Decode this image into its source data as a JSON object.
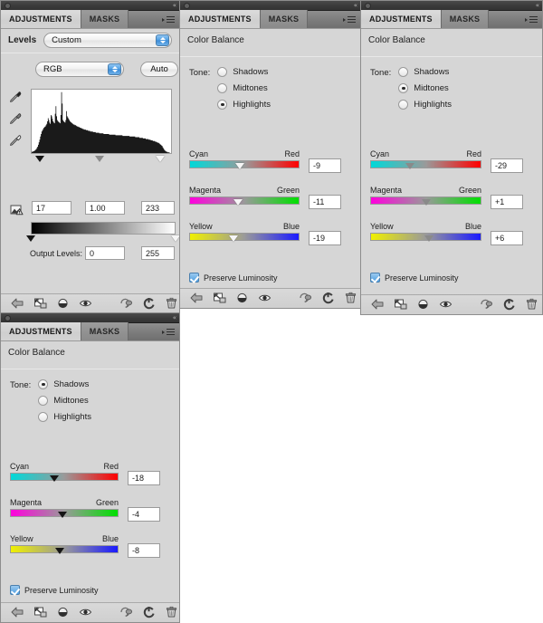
{
  "app": {
    "tabs": [
      "ADJUSTMENTS",
      "MASKS"
    ],
    "collapse_glyph": "«",
    "menu_icon": "panel-menu-icon"
  },
  "panels": [
    {
      "id": "levels",
      "type": "levels",
      "active_tab": "ADJUSTMENTS",
      "inactive_tab": "MASKS",
      "title_label": "Levels",
      "preset": "Custom",
      "channel": "RGB",
      "auto_label": "Auto",
      "input_levels": {
        "black": "17",
        "gamma": "1.00",
        "white": "233"
      },
      "output_levels_label": "Output Levels:",
      "output_levels": {
        "black": "0",
        "white": "255"
      },
      "histogram": [
        2,
        2,
        3,
        3,
        4,
        5,
        6,
        8,
        10,
        13,
        17,
        21,
        26,
        30,
        34,
        36,
        38,
        40,
        41,
        42,
        44,
        46,
        50,
        55,
        52,
        48,
        46,
        60,
        58,
        54,
        50,
        48,
        47,
        62,
        74,
        58,
        52,
        50,
        49,
        48,
        47,
        60,
        96,
        78,
        52,
        50,
        49,
        48,
        52,
        66,
        58,
        56,
        54,
        52,
        50,
        49,
        48,
        47,
        46,
        45,
        45,
        44,
        44,
        43,
        42,
        42,
        41,
        41,
        40,
        40,
        39,
        39,
        38,
        38,
        37,
        37,
        37,
        36,
        36,
        36,
        35,
        35,
        35,
        34,
        34,
        34,
        34,
        33,
        33,
        33,
        33,
        32,
        32,
        32,
        32,
        32,
        31,
        31,
        31,
        31,
        31,
        31,
        30,
        30,
        30,
        30,
        30,
        30,
        30,
        30,
        29,
        29,
        29,
        29,
        29,
        29,
        29,
        29,
        29,
        28,
        28,
        28,
        28,
        28,
        28,
        28,
        28,
        28,
        28,
        27,
        27,
        27,
        27,
        27,
        27,
        27,
        27,
        27,
        27,
        26,
        26,
        26,
        26,
        26,
        26,
        26,
        26,
        25,
        25,
        25,
        25,
        25,
        25,
        24,
        24,
        24,
        24,
        24,
        23,
        23,
        23,
        23,
        22,
        22,
        22,
        22,
        21,
        21,
        21,
        20,
        20,
        20,
        19,
        19,
        19,
        18,
        18,
        17,
        17,
        16,
        16,
        15,
        14,
        13,
        12,
        11,
        9,
        7,
        5,
        4,
        3,
        2,
        2,
        1,
        1,
        1,
        0,
        0
      ]
    },
    {
      "id": "cb-highlights",
      "type": "color-balance",
      "active_tab": "ADJUSTMENTS",
      "inactive_tab": "MASKS",
      "title_label": "Color Balance",
      "tone_label": "Tone:",
      "tone_options": [
        "Shadows",
        "Midtones",
        "Highlights"
      ],
      "tone_selected": "Highlights",
      "thumb_style": "white",
      "sliders": [
        {
          "left_label": "Cyan",
          "right_label": "Red",
          "value": "-9",
          "track": "cr"
        },
        {
          "left_label": "Magenta",
          "right_label": "Green",
          "value": "-11",
          "track": "mg"
        },
        {
          "left_label": "Yellow",
          "right_label": "Blue",
          "value": "-19",
          "track": "yb"
        }
      ],
      "preserve_luminosity_label": "Preserve Luminosity",
      "preserve_luminosity": true
    },
    {
      "id": "cb-midtones",
      "type": "color-balance",
      "active_tab": "ADJUSTMENTS",
      "inactive_tab": "MASKS",
      "title_label": "Color Balance",
      "tone_label": "Tone:",
      "tone_options": [
        "Shadows",
        "Midtones",
        "Highlights"
      ],
      "tone_selected": "Midtones",
      "thumb_style": "gray",
      "sliders": [
        {
          "left_label": "Cyan",
          "right_label": "Red",
          "value": "-29",
          "track": "cr"
        },
        {
          "left_label": "Magenta",
          "right_label": "Green",
          "value": "+1",
          "track": "mg"
        },
        {
          "left_label": "Yellow",
          "right_label": "Blue",
          "value": "+6",
          "track": "yb"
        }
      ],
      "preserve_luminosity_label": "Preserve Luminosity",
      "preserve_luminosity": true
    },
    {
      "id": "cb-shadows",
      "type": "color-balance",
      "active_tab": "ADJUSTMENTS",
      "inactive_tab": "MASKS",
      "title_label": "Color Balance",
      "tone_label": "Tone:",
      "tone_options": [
        "Shadows",
        "Midtones",
        "Highlights"
      ],
      "tone_selected": "Shadows",
      "thumb_style": "black",
      "sliders": [
        {
          "left_label": "Cyan",
          "right_label": "Red",
          "value": "-18",
          "track": "cr"
        },
        {
          "left_label": "Magenta",
          "right_label": "Green",
          "value": "-4",
          "track": "mg"
        },
        {
          "left_label": "Yellow",
          "right_label": "Blue",
          "value": "-8",
          "track": "yb"
        }
      ],
      "preserve_luminosity_label": "Preserve Luminosity",
      "preserve_luminosity": true
    }
  ],
  "toolbar": {
    "icons": [
      "return-to-previous-state-icon",
      "clip-to-layer-icon",
      "view-previous-state-icon",
      "toggle-layer-visibility-icon",
      "mask-view-icon",
      "reset-adjustment-icon",
      "delete-adjustment-layer-icon"
    ]
  },
  "colors": {
    "panel_bg": "#d6d6d6",
    "titlebar": "#3a3a3a",
    "tab_active": "#d3d3d3",
    "accent_blue": "#4e9ee0"
  }
}
